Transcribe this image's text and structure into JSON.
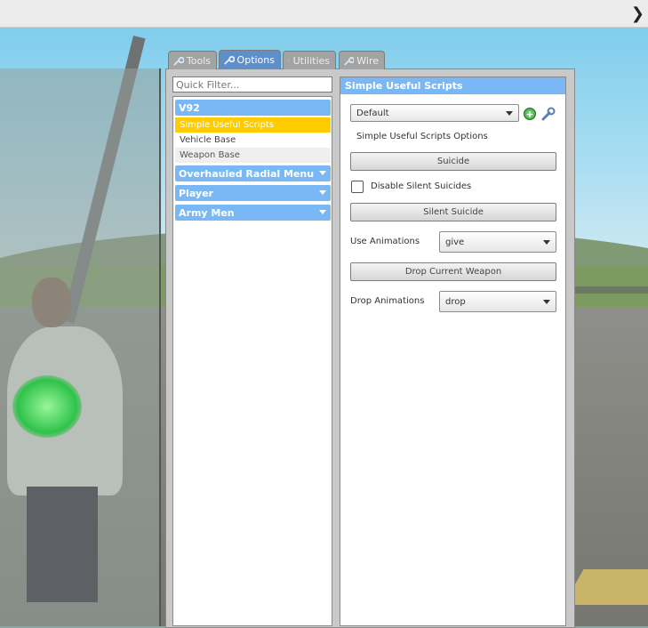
{
  "tabs": [
    {
      "label": "Tools",
      "icon": "wrench-icon"
    },
    {
      "label": "Options",
      "icon": "wrench-icon"
    },
    {
      "label": "Utilities",
      "icon": "utilities-icon"
    },
    {
      "label": "Wire",
      "icon": "wrench-icon"
    }
  ],
  "sidebar": {
    "filter_placeholder": "Quick Filter...",
    "categories": [
      {
        "label": "V92",
        "items": [
          "Simple Useful Scripts",
          "Vehicle Base",
          "Weapon Base"
        ]
      },
      {
        "label": "Overhauled Radial Menu"
      },
      {
        "label": "Player"
      },
      {
        "label": "Army Men"
      }
    ]
  },
  "panel": {
    "title": "Simple Useful Scripts",
    "preset": "Default",
    "options_title": "Simple Useful Scripts Options",
    "suicide_button": "Suicide",
    "disable_silent_label": "Disable Silent Suicides",
    "silent_suicide_button": "Silent Suicide",
    "use_animations_label": "Use Animations",
    "use_animations_value": "give",
    "drop_weapon_button": "Drop Current Weapon",
    "drop_animations_label": "Drop Animations",
    "drop_animations_value": "drop"
  },
  "colors": {
    "accent": "#7ab8f5",
    "active_tab": "#5f8fc9",
    "selected_item": "#ffcc00"
  }
}
